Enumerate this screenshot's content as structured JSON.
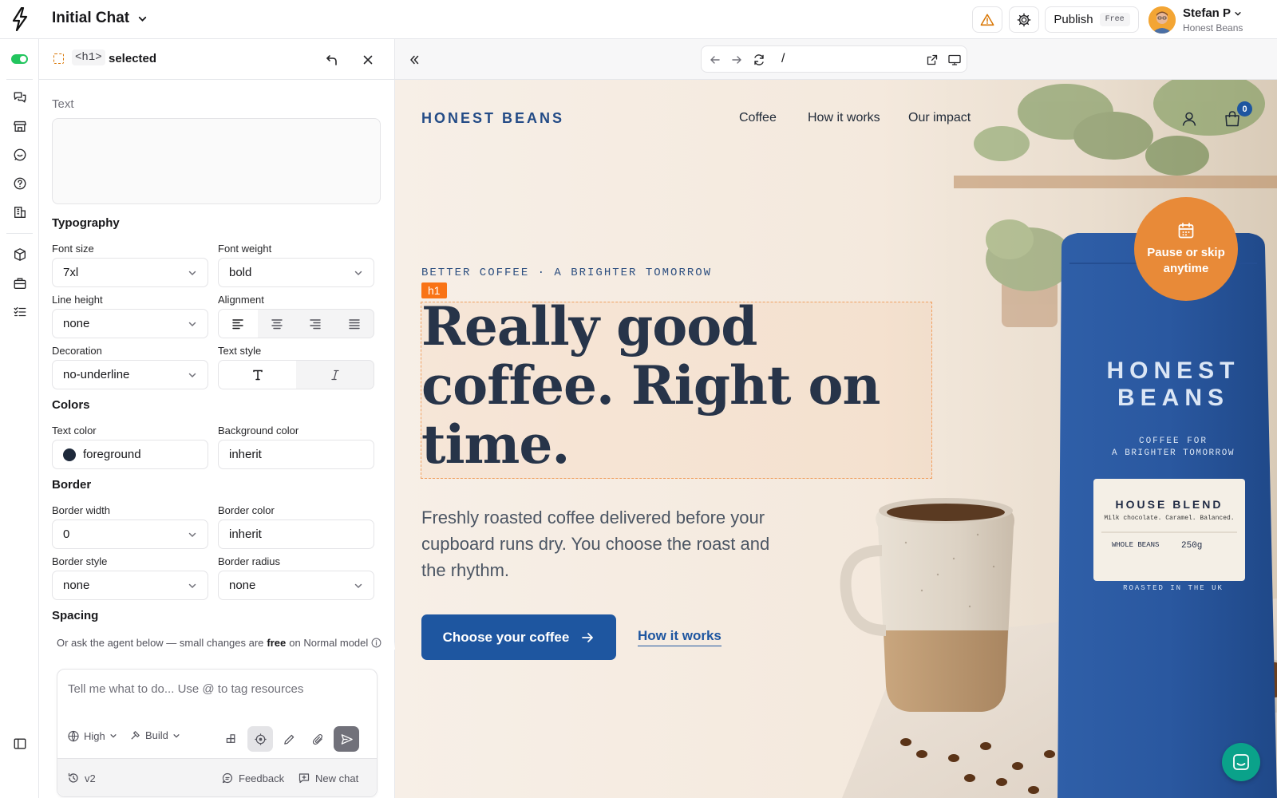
{
  "app": {
    "chat_title": "Initial Chat",
    "publish_label": "Publish",
    "plan_badge": "Free",
    "user_name": "Stefan P",
    "user_org": "Honest Beans"
  },
  "panel": {
    "selected_tag": "<h1>",
    "selected_suffix": "selected",
    "text_label": "Text",
    "typography": {
      "heading": "Typography",
      "font_size_label": "Font size",
      "font_size_value": "7xl",
      "font_weight_label": "Font weight",
      "font_weight_value": "bold",
      "line_height_label": "Line height",
      "line_height_value": "none",
      "alignment_label": "Alignment",
      "decoration_label": "Decoration",
      "decoration_value": "no-underline",
      "text_style_label": "Text style"
    },
    "colors": {
      "heading": "Colors",
      "text_color_label": "Text color",
      "text_color_value": "foreground",
      "background_color_label": "Background color",
      "background_color_value": "inherit"
    },
    "border": {
      "heading": "Border",
      "width_label": "Border width",
      "width_value": "0",
      "color_label": "Border color",
      "color_value": "inherit",
      "style_label": "Border style",
      "style_value": "none",
      "radius_label": "Border radius",
      "radius_value": "none"
    },
    "spacing_heading": "Spacing"
  },
  "agent": {
    "hint_pre": "Or ask the agent below — small changes are",
    "hint_bold": "free",
    "hint_post": "on Normal model",
    "placeholder": "Tell me what to do... Use @ to tag resources",
    "effort_label": "High",
    "mode_label": "Build",
    "version_label": "v2",
    "feedback_label": "Feedback",
    "new_chat_label": "New chat"
  },
  "preview": {
    "url_path": "/"
  },
  "site": {
    "brand": "HONEST BEANS",
    "nav": [
      "Coffee",
      "How it works",
      "Our impact"
    ],
    "cart_count": "0",
    "eyebrow": "BETTER COFFEE · A BRIGHTER TOMORROW",
    "element_badge": "h1",
    "headline": "Really good coffee. Right on time.",
    "subcopy": "Freshly roasted coffee delivered before your cupboard runs dry. You choose the roast and the rhythm.",
    "cta_label": "Choose your coffee",
    "secondary_label": "How it works",
    "pause_badge": "Pause or skip anytime",
    "bag": {
      "brand_line1": "HONEST",
      "brand_line2": "BEANS",
      "tagline1": "COFFEE FOR",
      "tagline2": "A BRIGHTER TOMORROW",
      "label_title": "HOUSE BLEND",
      "label_notes": "Milk chocolate. Caramel. Balanced.",
      "label_type": "WHOLE BEANS",
      "label_weight": "250g",
      "footer": "ROASTED IN THE UK"
    }
  },
  "colors": {
    "accent_blue": "#1e56a0",
    "badge_orange": "#e88a38",
    "selection_orange": "#f97316",
    "status_green": "#22c55e",
    "chat_teal": "#0aa28a"
  },
  "icons": [
    "bolt-logo-icon",
    "chevron-down-icon",
    "warning-icon",
    "gear-icon",
    "chat-bubbles-icon",
    "store-icon",
    "support-icon",
    "help-icon",
    "building-icon",
    "package-icon",
    "briefcase-icon",
    "checklist-icon",
    "sidebar-icon",
    "undo-icon",
    "close-icon",
    "double-chevron-left-icon",
    "arrow-left-icon",
    "arrow-right-icon",
    "refresh-icon",
    "external-link-icon",
    "monitor-icon",
    "calendar-icon",
    "user-icon",
    "bag-icon",
    "arrow-right-icon",
    "globe-icon",
    "hammer-icon",
    "components-icon",
    "target-icon",
    "pencil-icon",
    "paperclip-icon",
    "send-icon",
    "history-icon",
    "feedback-icon",
    "new-chat-icon",
    "info-icon",
    "align-left-icon",
    "align-center-icon",
    "align-right-icon",
    "align-justify-icon",
    "text-icon",
    "italic-icon",
    "messenger-icon"
  ]
}
